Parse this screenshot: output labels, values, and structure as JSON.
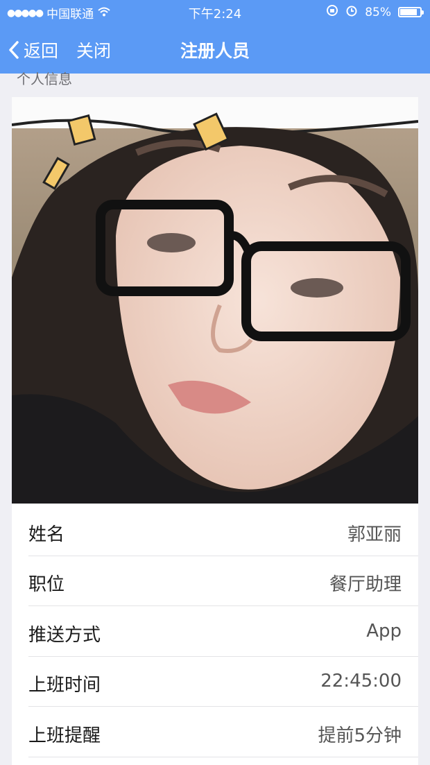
{
  "status_bar": {
    "carrier": "中国联通",
    "time": "下午2:24",
    "battery": "85%",
    "icons": [
      "signal-dots-icon",
      "wifi-icon",
      "lock-rotation-icon",
      "alarm-icon",
      "battery-icon"
    ]
  },
  "nav": {
    "back_label": "返回",
    "close_label": "关闭",
    "title": "注册人员"
  },
  "section": {
    "header": "个人信息"
  },
  "fields": [
    {
      "label": "姓名",
      "value": "郭亚丽"
    },
    {
      "label": "职位",
      "value": "餐厅助理"
    },
    {
      "label": "推送方式",
      "value": "App"
    },
    {
      "label": "上班时间",
      "value": "22:45:00"
    },
    {
      "label": "上班提醒",
      "value": "提前5分钟"
    }
  ],
  "colors": {
    "nav_bg": "#5b9af5",
    "page_bg": "#efeff4"
  }
}
